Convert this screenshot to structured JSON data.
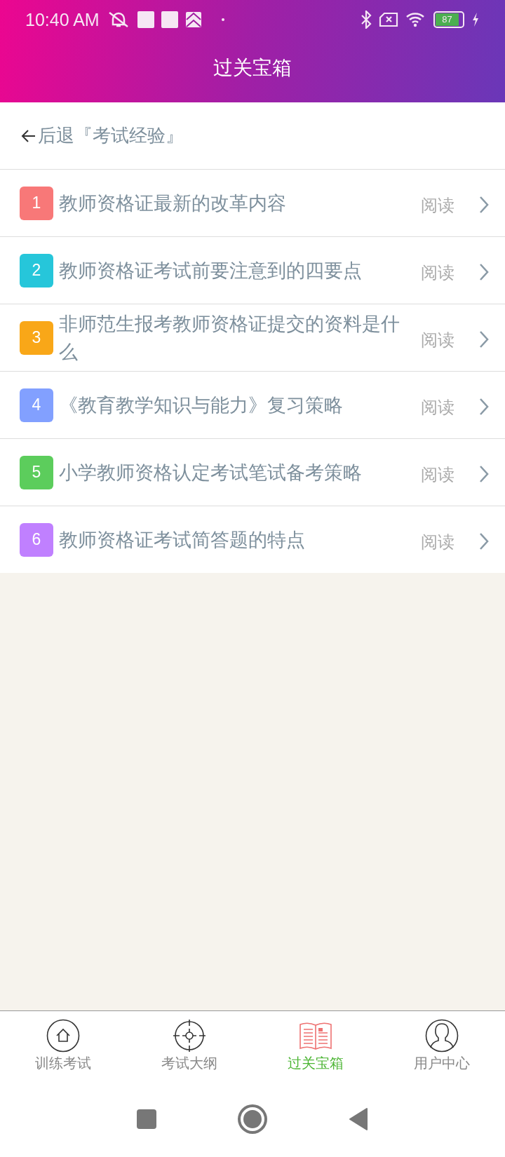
{
  "status_bar": {
    "time": "10:40 AM",
    "battery": "87"
  },
  "header": {
    "title": "过关宝箱"
  },
  "back_link": {
    "label": "后退『考试经验』"
  },
  "articles": [
    {
      "number": "1",
      "title": "教师资格证最新的改革内容",
      "action": "阅读",
      "color": "#f87878"
    },
    {
      "number": "2",
      "title": "教师资格证考试前要注意到的四要点",
      "action": "阅读",
      "color": "#26c6da"
    },
    {
      "number": "3",
      "title": "非师范生报考教师资格证提交的资料是什么",
      "action": "阅读",
      "color": "#f9a718"
    },
    {
      "number": "4",
      "title": "《教育教学知识与能力》复习策略",
      "action": "阅读",
      "color": "#82a0ff"
    },
    {
      "number": "5",
      "title": "小学教师资格认定考试笔试备考策略",
      "action": "阅读",
      "color": "#5ccd5c"
    },
    {
      "number": "6",
      "title": "教师资格证考试简答题的特点",
      "action": "阅读",
      "color": "#c080ff"
    }
  ],
  "tabs": [
    {
      "label": "训练考试",
      "kind": "home",
      "selected": false
    },
    {
      "label": "考试大纲",
      "kind": "target",
      "selected": false
    },
    {
      "label": "过关宝箱",
      "kind": "book",
      "selected": true
    },
    {
      "label": "用户中心",
      "kind": "user",
      "selected": false
    }
  ]
}
